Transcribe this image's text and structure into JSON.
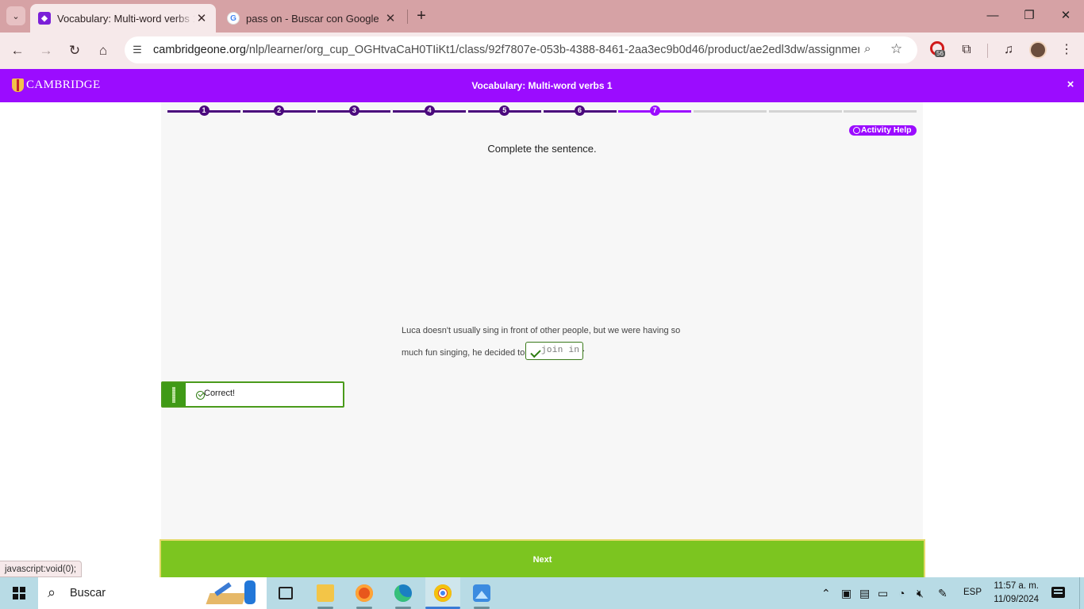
{
  "browser": {
    "tabs": [
      {
        "title": "Vocabulary: Multi-word verbs 1",
        "favicon": "cambridge-favicon",
        "active": true
      },
      {
        "title": "pass on - Buscar con Google",
        "favicon": "google-favicon",
        "active": false
      }
    ],
    "url_host": "cambridgeone.org",
    "url_path": "/nlp/learner/org_cup_OGHtvaCaH0TIiKt1/class/92f7807e-053b-4388-8461-2aa3ec9b0d46/product/ae2edl3dw/assignment/...",
    "extension_badge": "56",
    "status_link": "javascript:void(0);"
  },
  "app": {
    "brand": "CAMBRIDGE",
    "title": "Vocabulary: Multi-word verbs 1",
    "close_symbol": "×",
    "accent_color": "#9b0cff"
  },
  "activity": {
    "steps": [
      "1",
      "2",
      "3",
      "4",
      "5",
      "6",
      "7",
      "",
      "",
      ""
    ],
    "current_step": 7,
    "help_label": "Activity Help",
    "instruction": "Complete the sentence.",
    "sentence_before": "Luca doesn't usually sing in front of other people, but we were having so much fun singing, he decided to",
    "answer": "join in",
    "sentence_after": ".",
    "feedback": "Correct!",
    "next_label": "Next"
  },
  "taskbar": {
    "search_label": "Buscar",
    "language": "ESP",
    "time": "11:57 a. m.",
    "date": "11/09/2024"
  }
}
